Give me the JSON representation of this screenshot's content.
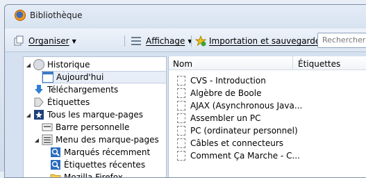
{
  "window": {
    "title": "Bibliothèque"
  },
  "toolbar": {
    "organize_label": "Organiser",
    "view_label": "Affichage",
    "import_label": "Importation et sauvegarde",
    "search_placeholder": "Rechercher d"
  },
  "sidebar": {
    "items": [
      {
        "label": "Historique",
        "icon": "history-icon",
        "expanded": true
      },
      {
        "label": "Aujourd'hui",
        "icon": "calendar-icon"
      },
      {
        "label": "Téléchargements",
        "icon": "download-icon"
      },
      {
        "label": "Étiquettes",
        "icon": "tag-icon"
      },
      {
        "label": "Tous les marque-pages",
        "icon": "bookmarks-icon",
        "expanded": true
      },
      {
        "label": "Barre personnelle",
        "icon": "toolbar-icon"
      },
      {
        "label": "Menu des marque-pages",
        "icon": "menu-icon",
        "expanded": true
      },
      {
        "label": "Marqués récemment",
        "icon": "smart-folder-icon"
      },
      {
        "label": "Étiquettes récentes",
        "icon": "smart-folder-icon"
      },
      {
        "label": "Mozilla Firefox",
        "icon": "folder-icon"
      }
    ]
  },
  "content": {
    "columns": [
      "Nom",
      "Étiquettes"
    ],
    "rows": [
      "CVS - Introduction",
      "Algèbre de Boole",
      "AJAX (Asynchronous Java...",
      "Assembler un PC",
      "PC (ordinateur personnel)",
      "Câbles et connecteurs",
      "Comment Ça Marche - C..."
    ]
  }
}
